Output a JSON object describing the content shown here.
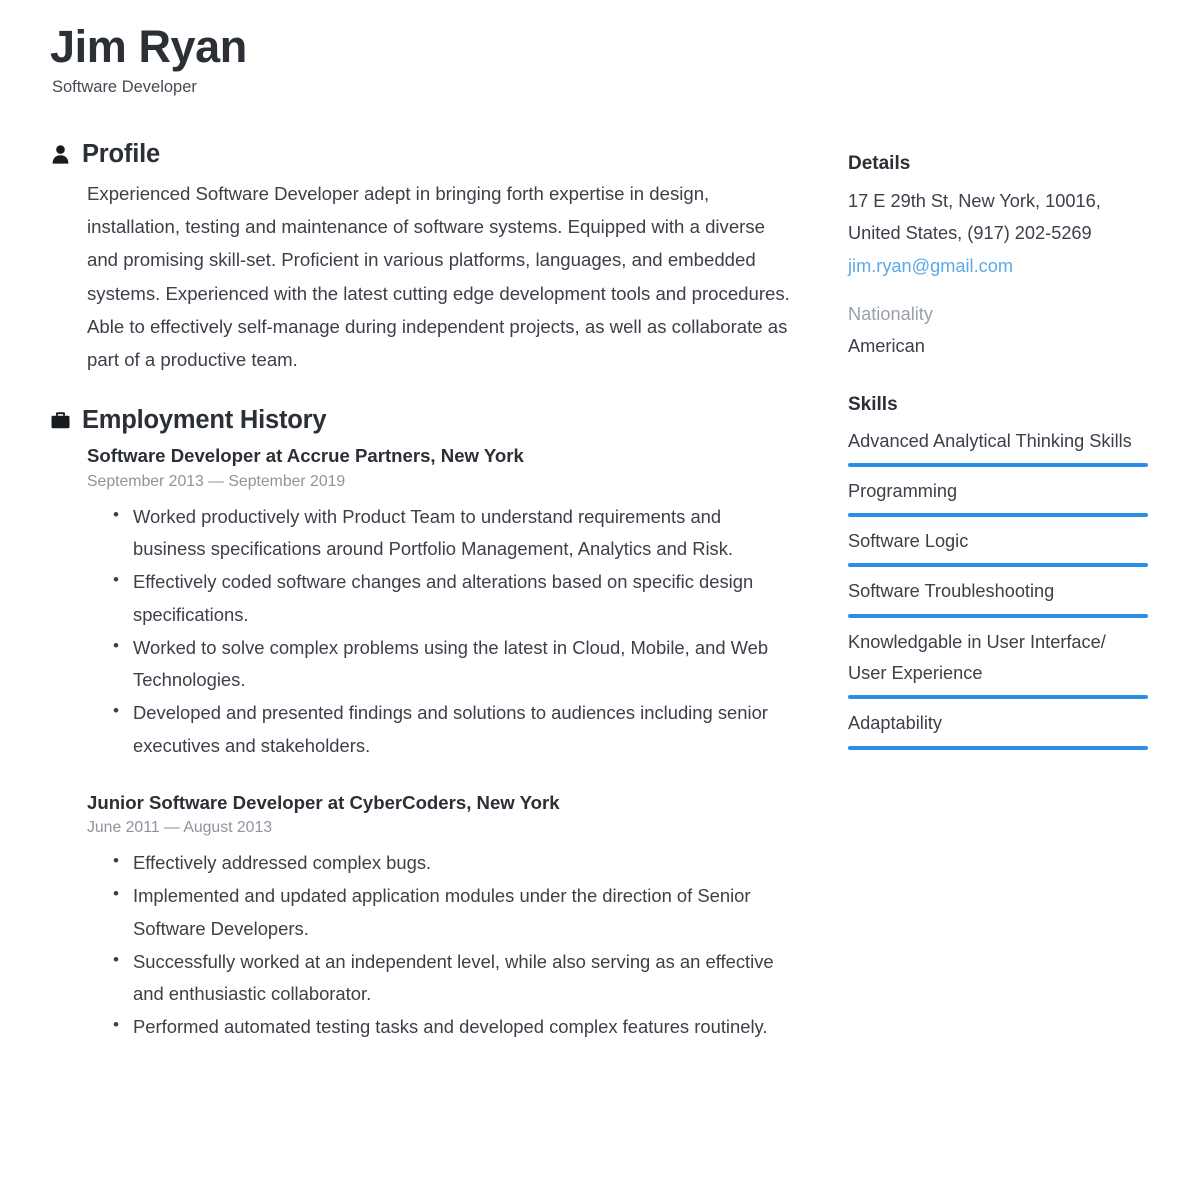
{
  "header": {
    "full_name": "Jim Ryan",
    "job_title": "Software Developer"
  },
  "profile": {
    "icon": "person-icon",
    "heading": "Profile",
    "text": "Experienced Software Developer adept in bringing forth expertise in design, installation, testing and maintenance of software systems. Equipped with a diverse and promising skill-set. Proficient in various platforms, languages, and embedded systems. Experienced with the latest cutting edge development tools and procedures.  Able to effectively self-manage during independent projects, as well as collaborate as part of a productive team."
  },
  "employment": {
    "icon": "briefcase-icon",
    "heading": "Employment History",
    "entries": [
      {
        "title": "Software Developer at  Accrue Partners, New York",
        "dates": "September 2013 — September 2019",
        "bullets": [
          "Worked productively with Product Team to understand requirements and business specifications around Portfolio Management, Analytics and Risk.",
          "Effectively coded software changes and alterations based on specific design specifications.",
          "Worked to solve complex problems using the latest in Cloud, Mobile, and Web Technologies.",
          "Developed and presented findings and solutions to audiences including senior executives and stakeholders."
        ]
      },
      {
        "title": "Junior Software Developer at  CyberCoders, New York",
        "dates": "June 2011 — August 2013",
        "bullets": [
          "Effectively addressed complex bugs.",
          "Implemented and updated application modules under the direction of Senior Software Developers.",
          "Successfully worked at an independent level, while also serving as an effective and enthusiastic collaborator.",
          "Performed automated testing tasks and developed complex features routinely."
        ]
      }
    ]
  },
  "details": {
    "heading": "Details",
    "address_line_1": "17 E 29th St, New York, 10016,",
    "address_line_2": "United States, (917) 202-5269",
    "email": "jim.ryan@gmail.com",
    "nationality_label": "Nationality",
    "nationality_value": "American"
  },
  "skills": {
    "heading": "Skills",
    "items": [
      {
        "name": "Advanced Analytical Thinking Skills",
        "level": 100
      },
      {
        "name": "Programming",
        "level": 100
      },
      {
        "name": "Software Logic",
        "level": 100
      },
      {
        "name": "Software Troubleshooting",
        "level": 100
      },
      {
        "name": "Knowledgable in User Interface/ User Experience",
        "level": 100
      },
      {
        "name": "Adaptability",
        "level": 100
      }
    ]
  },
  "colors": {
    "accent_bar": "#2b8fe8",
    "link": "#5ba9e8",
    "heading": "#2b2f36",
    "body": "#3b4049",
    "muted": "#8d949e"
  }
}
